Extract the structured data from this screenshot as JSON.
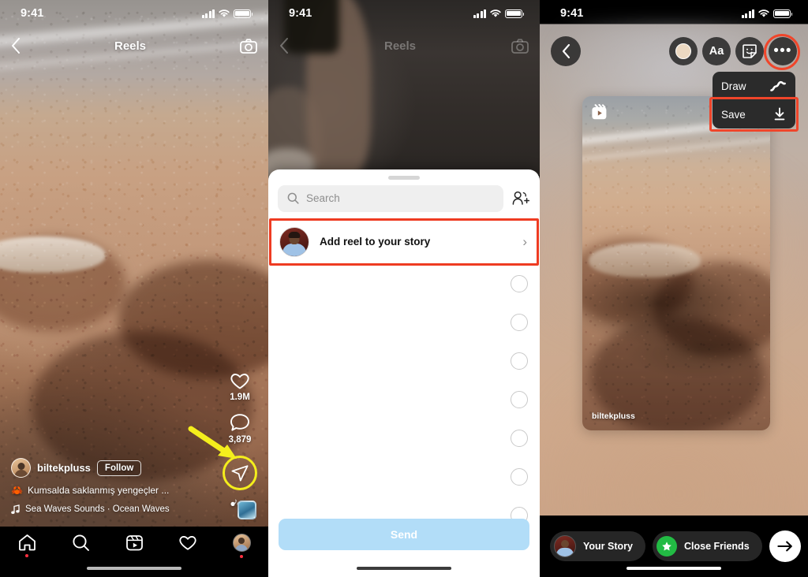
{
  "panels": {
    "reels": {
      "status": {
        "time": "9:41"
      },
      "topbar": {
        "title": "Reels",
        "back_icon": "chevron-left-icon",
        "camera_icon": "camera-icon"
      },
      "rail": {
        "like_icon": "heart-icon",
        "like_count": "1.9M",
        "comment_icon": "comment-bubble-icon",
        "comment_count": "3,879",
        "share_icon": "paper-plane-share-icon",
        "more_icon": "more-horizontal-icon",
        "highlight_color": "#f4ee1c"
      },
      "meta": {
        "username": "biltekpluss",
        "follow_label": "Follow",
        "caption": "Kumsalda saklanmış yengeçler ...",
        "caption_emoji": "🦀",
        "audio_icon": "music-note-icon",
        "audio": "Sea Waves Sounds · Ocean Waves"
      },
      "tabbar": {
        "items": [
          {
            "name": "home",
            "icon": "home-icon",
            "dot": true
          },
          {
            "name": "search",
            "icon": "search-icon",
            "dot": false
          },
          {
            "name": "reels",
            "icon": "reels-clapper-icon",
            "dot": false
          },
          {
            "name": "activity",
            "icon": "heart-icon",
            "dot": false
          },
          {
            "name": "profile",
            "icon": "profile-avatar-icon",
            "dot": true
          }
        ]
      }
    },
    "share_sheet": {
      "status": {
        "time": "9:41"
      },
      "topbar": {
        "title": "Reels",
        "back_icon": "chevron-left-icon",
        "camera_icon": "camera-icon"
      },
      "search": {
        "placeholder": "Search",
        "value": "",
        "icon": "search-icon",
        "add_people_icon": "add-people-icon"
      },
      "story_row": {
        "label": "Add reel to your story",
        "chevron": "›",
        "highlighted": true,
        "highlight_color": "#ee3b22"
      },
      "rows_count": 7,
      "send_label": "Send",
      "send_color": "#b2ddf8"
    },
    "story_editor": {
      "status": {
        "time": "9:41"
      },
      "toolbar": {
        "back_icon": "chevron-left-icon",
        "color_icon": "color-picker-icon",
        "text_label": "Aa",
        "sticker_icon": "sticker-smiley-icon",
        "more_icon": "more-horizontal-icon",
        "more_highlighted": true,
        "highlight_color": "#f0452a"
      },
      "menu": {
        "items": [
          {
            "label": "Draw",
            "icon": "squiggle-draw-icon",
            "highlighted": false
          },
          {
            "label": "Save",
            "icon": "download-arrow-icon",
            "highlighted": true
          }
        ]
      },
      "media_card": {
        "reel_icon": "reels-clapper-icon",
        "username": "biltekpluss"
      },
      "bottom": {
        "your_story_label": "Your Story",
        "close_friends_label": "Close Friends",
        "close_friends_icon": "green-star-icon",
        "close_friends_color": "#22bb44",
        "next_icon": "arrow-right-icon"
      }
    }
  }
}
